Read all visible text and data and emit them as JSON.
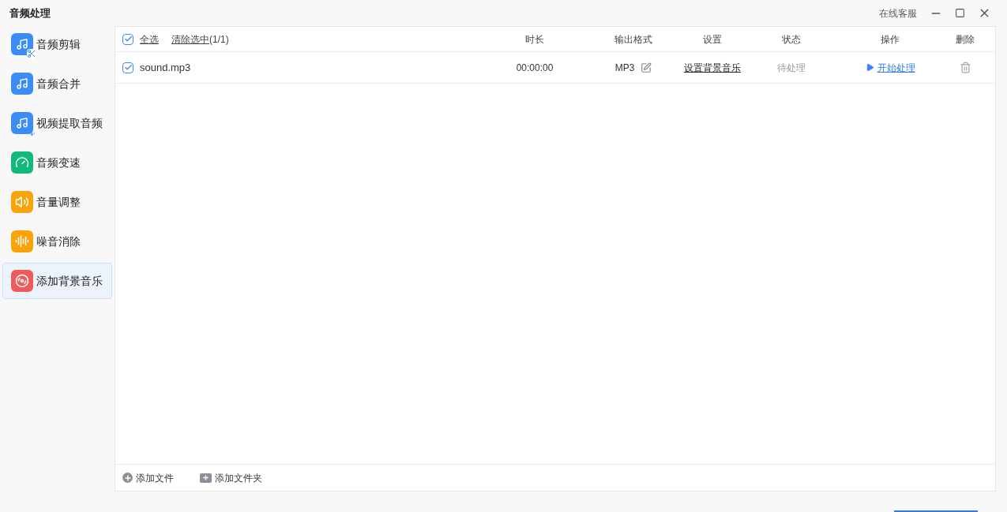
{
  "window": {
    "title": "音频处理",
    "support_link": "在线客服"
  },
  "sidebar": {
    "items": [
      {
        "label": "音频剪辑",
        "selected": false
      },
      {
        "label": "音频合并",
        "selected": false
      },
      {
        "label": "视频提取音频",
        "selected": false
      },
      {
        "label": "音频变速",
        "selected": false
      },
      {
        "label": "音量调整",
        "selected": false
      },
      {
        "label": "噪音消除",
        "selected": false
      },
      {
        "label": "添加背景音乐",
        "selected": true
      }
    ]
  },
  "table": {
    "select_all": {
      "label": "全选",
      "checked": true
    },
    "clear_selection": "清除选中",
    "selection_count": "(1/1)",
    "columns": [
      "时长",
      "输出格式",
      "设置",
      "状态",
      "操作",
      "删除"
    ],
    "rows": [
      {
        "checked": true,
        "name": "sound.mp3",
        "duration": "00:00:00",
        "format": "MP3",
        "settings": "设置背景音乐",
        "status": "待处理",
        "action": "开始处理"
      }
    ]
  },
  "footer": {
    "add_file": "添加文件",
    "add_folder": "添加文件夹"
  }
}
